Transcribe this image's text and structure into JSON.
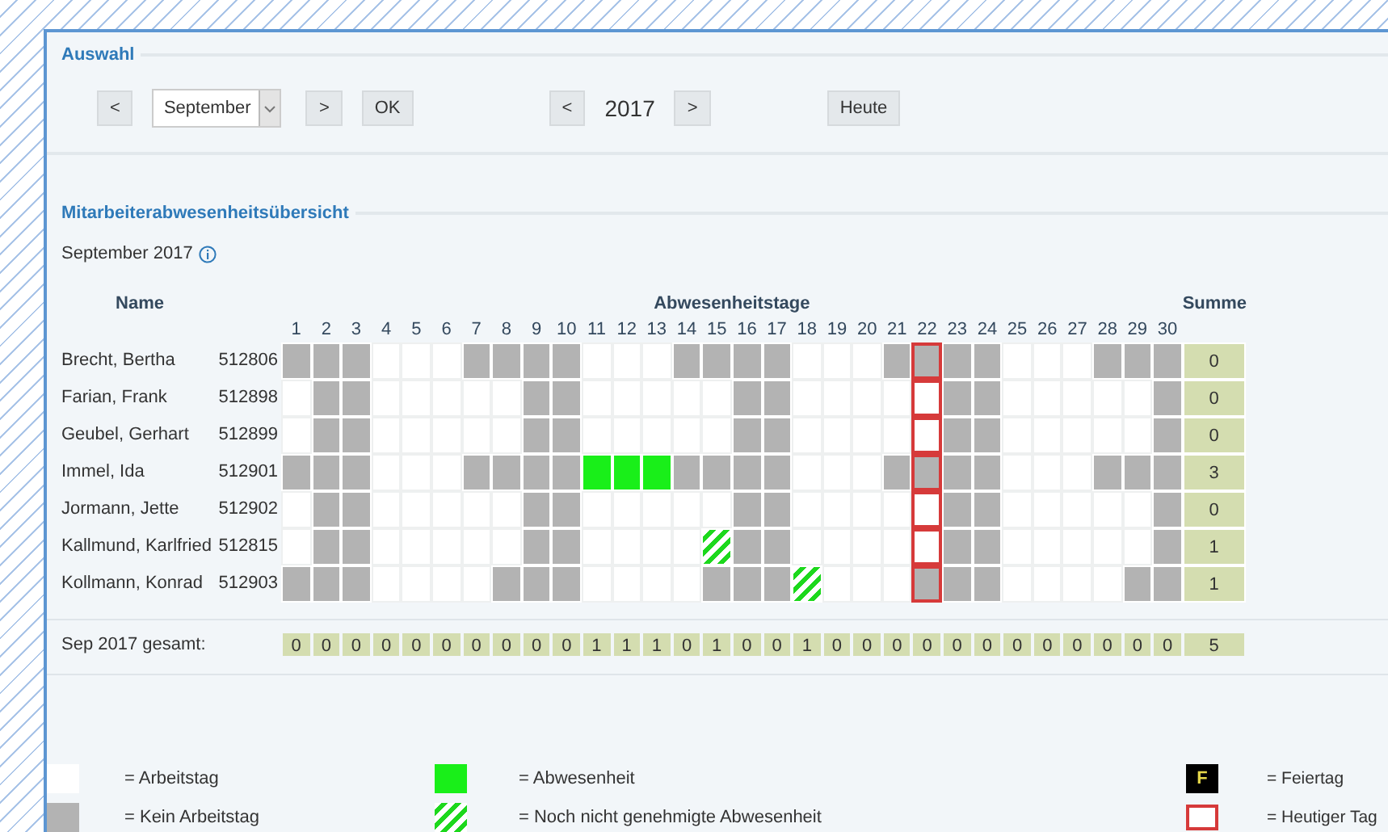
{
  "selection": {
    "title": "Auswahl",
    "month_prev": "<",
    "month": "September",
    "month_next": ">",
    "ok": "OK",
    "year_prev": "<",
    "year": "2017",
    "year_next": ">",
    "today_button": "Heute"
  },
  "overview": {
    "title": "Mitarbeiterabwesenheitsübersicht",
    "period": "September 2017",
    "columns": {
      "name": "Name",
      "days": "Abwesenheitstage",
      "sum": "Summe"
    },
    "days": [
      {
        "label": "1",
        "today": false
      },
      {
        "label": "2",
        "today": false
      },
      {
        "label": "3",
        "today": false
      },
      {
        "label": "4",
        "today": false
      },
      {
        "label": "5",
        "today": false
      },
      {
        "label": "6",
        "today": false
      },
      {
        "label": "7",
        "today": false
      },
      {
        "label": "8",
        "today": false
      },
      {
        "label": "9",
        "today": false
      },
      {
        "label": "10",
        "today": false
      },
      {
        "label": "11",
        "today": false
      },
      {
        "label": "12",
        "today": false
      },
      {
        "label": "13",
        "today": false
      },
      {
        "label": "14",
        "today": false
      },
      {
        "label": "15",
        "today": false
      },
      {
        "label": "16",
        "today": false
      },
      {
        "label": "17",
        "today": false
      },
      {
        "label": "18",
        "today": false
      },
      {
        "label": "19",
        "today": false
      },
      {
        "label": "20",
        "today": false
      },
      {
        "label": "21",
        "today": false
      },
      {
        "label": "22",
        "today": true
      },
      {
        "label": "23",
        "today": false
      },
      {
        "label": "24",
        "today": false
      },
      {
        "label": "25",
        "today": false
      },
      {
        "label": "26",
        "today": false
      },
      {
        "label": "27",
        "today": false
      },
      {
        "label": "28",
        "today": false
      },
      {
        "label": "29",
        "today": false
      },
      {
        "label": "30",
        "today": false
      }
    ],
    "rows": [
      {
        "name": "Brecht, Bertha",
        "id": "512806",
        "sum": "0",
        "cells": [
          {
            "kind": "off"
          },
          {
            "kind": "off"
          },
          {
            "kind": "off"
          },
          {
            "kind": "work"
          },
          {
            "kind": "work"
          },
          {
            "kind": "work"
          },
          {
            "kind": "off"
          },
          {
            "kind": "off"
          },
          {
            "kind": "off"
          },
          {
            "kind": "off"
          },
          {
            "kind": "work"
          },
          {
            "kind": "work"
          },
          {
            "kind": "work"
          },
          {
            "kind": "off"
          },
          {
            "kind": "off"
          },
          {
            "kind": "off"
          },
          {
            "kind": "off"
          },
          {
            "kind": "work"
          },
          {
            "kind": "work"
          },
          {
            "kind": "work"
          },
          {
            "kind": "off"
          },
          {
            "kind": "off"
          },
          {
            "kind": "off"
          },
          {
            "kind": "off"
          },
          {
            "kind": "work"
          },
          {
            "kind": "work"
          },
          {
            "kind": "work"
          },
          {
            "kind": "off"
          },
          {
            "kind": "off"
          },
          {
            "kind": "off"
          }
        ]
      },
      {
        "name": "Farian, Frank",
        "id": "512898",
        "sum": "0",
        "cells": [
          {
            "kind": "work"
          },
          {
            "kind": "off"
          },
          {
            "kind": "off"
          },
          {
            "kind": "work"
          },
          {
            "kind": "work"
          },
          {
            "kind": "work"
          },
          {
            "kind": "work"
          },
          {
            "kind": "work"
          },
          {
            "kind": "off"
          },
          {
            "kind": "off"
          },
          {
            "kind": "work"
          },
          {
            "kind": "work"
          },
          {
            "kind": "work"
          },
          {
            "kind": "work"
          },
          {
            "kind": "work"
          },
          {
            "kind": "off"
          },
          {
            "kind": "off"
          },
          {
            "kind": "work"
          },
          {
            "kind": "work"
          },
          {
            "kind": "work"
          },
          {
            "kind": "work"
          },
          {
            "kind": "work"
          },
          {
            "kind": "off"
          },
          {
            "kind": "off"
          },
          {
            "kind": "work"
          },
          {
            "kind": "work"
          },
          {
            "kind": "work"
          },
          {
            "kind": "work"
          },
          {
            "kind": "work"
          },
          {
            "kind": "off"
          }
        ]
      },
      {
        "name": "Geubel, Gerhart",
        "id": "512899",
        "sum": "0",
        "cells": [
          {
            "kind": "work"
          },
          {
            "kind": "off"
          },
          {
            "kind": "off"
          },
          {
            "kind": "work"
          },
          {
            "kind": "work"
          },
          {
            "kind": "work"
          },
          {
            "kind": "work"
          },
          {
            "kind": "work"
          },
          {
            "kind": "off"
          },
          {
            "kind": "off"
          },
          {
            "kind": "work"
          },
          {
            "kind": "work"
          },
          {
            "kind": "work"
          },
          {
            "kind": "work"
          },
          {
            "kind": "work"
          },
          {
            "kind": "off"
          },
          {
            "kind": "off"
          },
          {
            "kind": "work"
          },
          {
            "kind": "work"
          },
          {
            "kind": "work"
          },
          {
            "kind": "work"
          },
          {
            "kind": "work"
          },
          {
            "kind": "off"
          },
          {
            "kind": "off"
          },
          {
            "kind": "work"
          },
          {
            "kind": "work"
          },
          {
            "kind": "work"
          },
          {
            "kind": "work"
          },
          {
            "kind": "work"
          },
          {
            "kind": "off"
          }
        ]
      },
      {
        "name": "Immel, Ida",
        "id": "512901",
        "sum": "3",
        "cells": [
          {
            "kind": "off"
          },
          {
            "kind": "off"
          },
          {
            "kind": "off"
          },
          {
            "kind": "work"
          },
          {
            "kind": "work"
          },
          {
            "kind": "work"
          },
          {
            "kind": "off"
          },
          {
            "kind": "off"
          },
          {
            "kind": "off"
          },
          {
            "kind": "off"
          },
          {
            "kind": "absent"
          },
          {
            "kind": "absent"
          },
          {
            "kind": "absent"
          },
          {
            "kind": "off"
          },
          {
            "kind": "off"
          },
          {
            "kind": "off"
          },
          {
            "kind": "off"
          },
          {
            "kind": "work"
          },
          {
            "kind": "work"
          },
          {
            "kind": "work"
          },
          {
            "kind": "off"
          },
          {
            "kind": "off"
          },
          {
            "kind": "off"
          },
          {
            "kind": "off"
          },
          {
            "kind": "work"
          },
          {
            "kind": "work"
          },
          {
            "kind": "work"
          },
          {
            "kind": "off"
          },
          {
            "kind": "off"
          },
          {
            "kind": "off"
          }
        ]
      },
      {
        "name": "Jormann, Jette",
        "id": "512902",
        "sum": "0",
        "cells": [
          {
            "kind": "work"
          },
          {
            "kind": "off"
          },
          {
            "kind": "off"
          },
          {
            "kind": "work"
          },
          {
            "kind": "work"
          },
          {
            "kind": "work"
          },
          {
            "kind": "work"
          },
          {
            "kind": "work"
          },
          {
            "kind": "off"
          },
          {
            "kind": "off"
          },
          {
            "kind": "work"
          },
          {
            "kind": "work"
          },
          {
            "kind": "work"
          },
          {
            "kind": "work"
          },
          {
            "kind": "work"
          },
          {
            "kind": "off"
          },
          {
            "kind": "off"
          },
          {
            "kind": "work"
          },
          {
            "kind": "work"
          },
          {
            "kind": "work"
          },
          {
            "kind": "work"
          },
          {
            "kind": "work"
          },
          {
            "kind": "off"
          },
          {
            "kind": "off"
          },
          {
            "kind": "work"
          },
          {
            "kind": "work"
          },
          {
            "kind": "work"
          },
          {
            "kind": "work"
          },
          {
            "kind": "work"
          },
          {
            "kind": "off"
          }
        ]
      },
      {
        "name": "Kallmund, Karlfried",
        "id": "512815",
        "sum": "1",
        "cells": [
          {
            "kind": "work"
          },
          {
            "kind": "off"
          },
          {
            "kind": "off"
          },
          {
            "kind": "work"
          },
          {
            "kind": "work"
          },
          {
            "kind": "work"
          },
          {
            "kind": "work"
          },
          {
            "kind": "work"
          },
          {
            "kind": "off"
          },
          {
            "kind": "off"
          },
          {
            "kind": "work"
          },
          {
            "kind": "work"
          },
          {
            "kind": "work"
          },
          {
            "kind": "work"
          },
          {
            "kind": "pending"
          },
          {
            "kind": "off"
          },
          {
            "kind": "off"
          },
          {
            "kind": "work"
          },
          {
            "kind": "work"
          },
          {
            "kind": "work"
          },
          {
            "kind": "work"
          },
          {
            "kind": "work"
          },
          {
            "kind": "off"
          },
          {
            "kind": "off"
          },
          {
            "kind": "work"
          },
          {
            "kind": "work"
          },
          {
            "kind": "work"
          },
          {
            "kind": "work"
          },
          {
            "kind": "work"
          },
          {
            "kind": "off"
          }
        ]
      },
      {
        "name": "Kollmann, Konrad",
        "id": "512903",
        "sum": "1",
        "cells": [
          {
            "kind": "off"
          },
          {
            "kind": "off"
          },
          {
            "kind": "off"
          },
          {
            "kind": "work"
          },
          {
            "kind": "work"
          },
          {
            "kind": "work"
          },
          {
            "kind": "work"
          },
          {
            "kind": "off"
          },
          {
            "kind": "off"
          },
          {
            "kind": "off"
          },
          {
            "kind": "work"
          },
          {
            "kind": "work"
          },
          {
            "kind": "work"
          },
          {
            "kind": "work"
          },
          {
            "kind": "off"
          },
          {
            "kind": "off"
          },
          {
            "kind": "off"
          },
          {
            "kind": "pending"
          },
          {
            "kind": "work"
          },
          {
            "kind": "work"
          },
          {
            "kind": "work"
          },
          {
            "kind": "off"
          },
          {
            "kind": "off"
          },
          {
            "kind": "off"
          },
          {
            "kind": "work"
          },
          {
            "kind": "work"
          },
          {
            "kind": "work"
          },
          {
            "kind": "work"
          },
          {
            "kind": "off"
          },
          {
            "kind": "off"
          }
        ]
      }
    ],
    "totals": {
      "label": "Sep 2017 gesamt:",
      "values": [
        "0",
        "0",
        "0",
        "0",
        "0",
        "0",
        "0",
        "0",
        "0",
        "0",
        "1",
        "1",
        "1",
        "0",
        "1",
        "0",
        "0",
        "1",
        "0",
        "0",
        "0",
        "0",
        "0",
        "0",
        "0",
        "0",
        "0",
        "0",
        "0",
        "0"
      ],
      "sum": "5"
    }
  },
  "legend": [
    {
      "kind": "workday",
      "label": "= Arbeitstag"
    },
    {
      "kind": "absence",
      "label": "= Abwesenheit"
    },
    {
      "kind": "holiday",
      "symbol": "F",
      "label": "= Feiertag"
    },
    {
      "kind": "non_workday",
      "label": "= Kein Arbeitstag"
    },
    {
      "kind": "pending",
      "label": "= Noch nicht genehmigte Abwesenheit"
    },
    {
      "kind": "today",
      "label": "= Heutiger Tag"
    }
  ]
}
